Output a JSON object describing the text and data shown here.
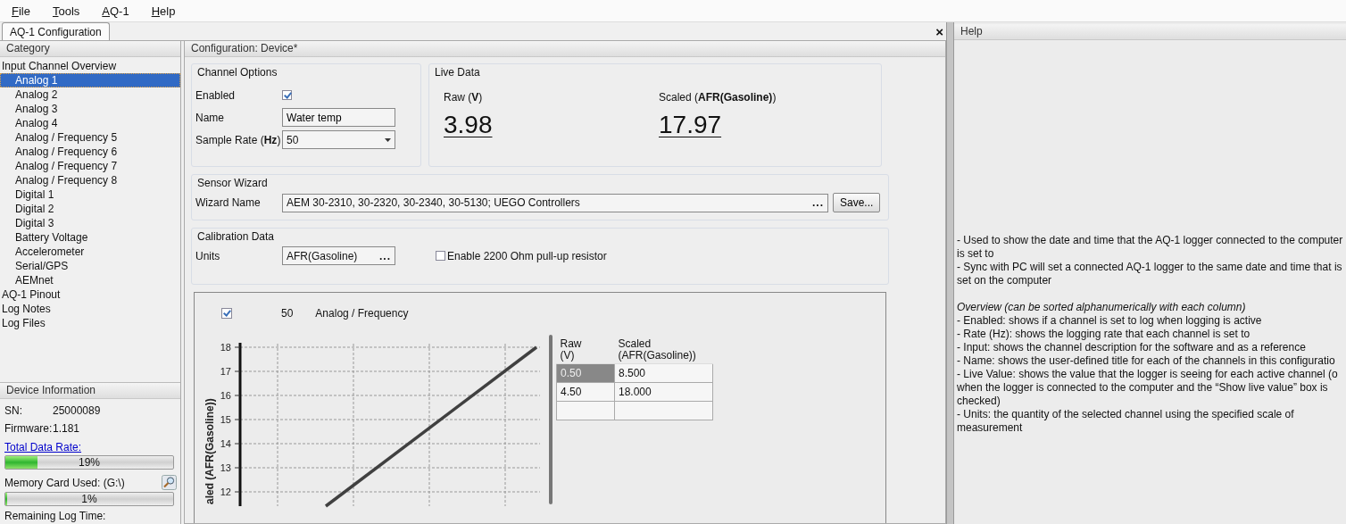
{
  "menu": [
    {
      "label": "File"
    },
    {
      "label": "Tools"
    },
    {
      "label": "AQ-1"
    },
    {
      "label": "Help"
    }
  ],
  "tab": {
    "label": "AQ-1 Configuration",
    "selected": true
  },
  "close_button": "×",
  "category": {
    "title": "Category",
    "items": [
      {
        "label": "Input Channel Overview",
        "selected": false,
        "children": [
          {
            "label": "Analog 1",
            "selected": true
          },
          {
            "label": "Analog 2",
            "selected": false
          },
          {
            "label": "Analog 3",
            "selected": false
          },
          {
            "label": "Analog 4",
            "selected": false
          },
          {
            "label": "Analog / Frequency 5",
            "selected": false
          },
          {
            "label": "Analog / Frequency 6",
            "selected": false
          },
          {
            "label": "Analog / Frequency 7",
            "selected": false
          },
          {
            "label": "Analog / Frequency 8",
            "selected": false
          },
          {
            "label": "Digital 1",
            "selected": false
          },
          {
            "label": "Digital 2",
            "selected": false
          },
          {
            "label": "Digital 3",
            "selected": false
          },
          {
            "label": "Battery Voltage",
            "selected": false
          },
          {
            "label": "Accelerometer",
            "selected": false
          },
          {
            "label": "Serial/GPS",
            "selected": false
          },
          {
            "label": "AEMnet",
            "selected": false
          }
        ]
      },
      {
        "label": "AQ-1 Pinout",
        "selected": false
      },
      {
        "label": "Log Notes",
        "selected": false
      },
      {
        "label": "Log Files",
        "selected": false
      }
    ]
  },
  "device_info": {
    "title": "Device Information",
    "fields": [
      {
        "label": "SN:",
        "value": "25000089"
      },
      {
        "label": "Firmware:",
        "value": "1.181"
      }
    ],
    "data_rate": {
      "link": "Total Data Rate:",
      "level": 0.19,
      "reading": "19%"
    },
    "memory": {
      "label": "Memory Card Used: (G:\\)",
      "level": 0.01,
      "reading": "1%"
    },
    "remaining_label": "Remaining Log Time:"
  },
  "config": {
    "title": "Configuration: Device*",
    "channel_options": {
      "title": "Channel Options",
      "enabled": {
        "label": "Enabled",
        "checked": true
      },
      "name": {
        "label": "Name",
        "value": "Water temp"
      },
      "sample_rate": {
        "label": "Sample Rate (**Hz**)",
        "value": "50"
      }
    },
    "live_data": {
      "title": "Live Data",
      "readings": [
        {
          "label": "Raw (**V**)",
          "value": "3.98"
        },
        {
          "label": "Scaled (**AFR(Gasoline)**)",
          "value": "17.97"
        }
      ]
    },
    "sensor_wizard": {
      "title": "Sensor Wizard",
      "label": "Wizard Name",
      "value": "AEM 30-2310, 30-2320, 30-2340, 30-5130; UEGO Controllers",
      "browse": "...",
      "save": "Save..."
    },
    "calibration": {
      "title": "Calibration Data",
      "units_label": "Units",
      "units_value": "AFR(Gasoline)",
      "browse": "...",
      "pullup": {
        "label": "Enable 2200 Ohm pull-up resistor",
        "checked": false
      },
      "overlay": {
        "checked": true,
        "rate": "50",
        "input": "Analog / Frequency"
      },
      "chart": {
        "ylabel": "aled (AFR(Gasoline))",
        "yticks": [
          "18",
          "17",
          "16",
          "15",
          "14",
          "13",
          "12"
        ]
      },
      "table": {
        "columns": [
          {
            "name": "Raw",
            "unit": "(V)"
          },
          {
            "name": "Scaled",
            "unit": "(AFR(Gasoline))"
          }
        ],
        "rows": [
          {
            "cells": [
              "0.50",
              "8.500"
            ],
            "selected": true
          },
          {
            "cells": [
              "4.50",
              "18.000"
            ],
            "selected": false
          }
        ]
      }
    }
  },
  "help": {
    "title": "Help",
    "paragraphs": [
      {
        "lines": [
          "- Used to show the date and time that the AQ-1 logger connected to the computer",
          "is set to",
          "- Sync with PC will set a connected AQ-1 logger to the same date and time that is",
          "set on the computer"
        ]
      },
      {
        "heading": "Overview (can be sorted alphanumerically with each column)",
        "lines": [
          "- Enabled: shows if a channel is set to log when logging is active",
          "- Rate (Hz): shows the logging rate that each channel is set to",
          "- Input: shows the channel description for the software and as a reference",
          "- Name: shows the user-defined title for each of the channels in this configuratio",
          "- Live Value: shows the value that the logger is seeing for each active channel (o",
          "when the logger is connected to the computer and the “Show live value” box is",
          "checked)",
          "- Units: the quantity of the selected channel using the specified scale of",
          "measurement"
        ]
      }
    ]
  }
}
